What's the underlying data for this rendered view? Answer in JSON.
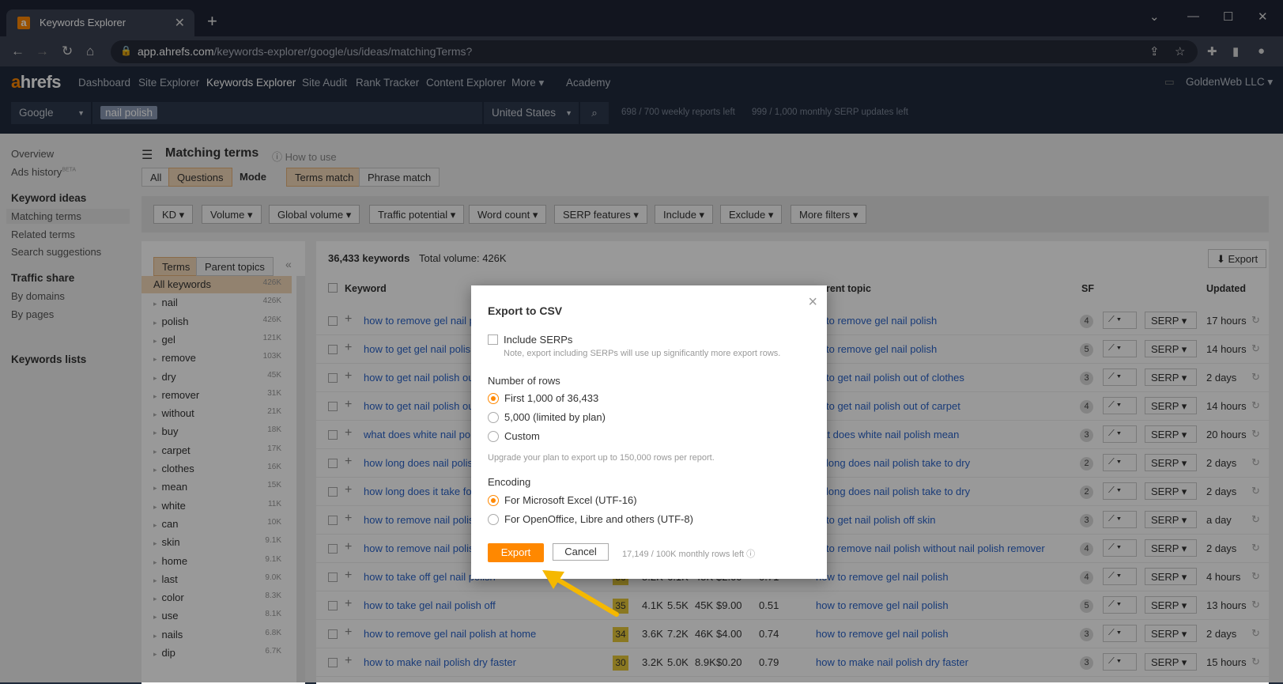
{
  "browser": {
    "tab_title": "Keywords Explorer",
    "favicon_letter": "a",
    "url_domain": "app.ahrefs.com",
    "url_path": "/keywords-explorer/google/us/ideas/matchingTerms?"
  },
  "header": {
    "logo_a": "a",
    "logo_rest": "hrefs",
    "nav": [
      "Dashboard",
      "Site Explorer",
      "Keywords Explorer",
      "Site Audit",
      "Rank Tracker",
      "Content Explorer",
      "More ▾",
      "Academy"
    ],
    "account": "GoldenWeb LLC",
    "engine": "Google",
    "query": "nail polish",
    "country": "United States",
    "weekly_quota": "698 / 700 weekly reports left",
    "monthly_quota": "999 / 1,000 monthly SERP updates left"
  },
  "sidebar": {
    "overview": "Overview",
    "ads_history": "Ads history",
    "beta": "BETA",
    "keyword_ideas": "Keyword ideas",
    "matching_terms": "Matching terms",
    "related_terms": "Related terms",
    "search_suggestions": "Search suggestions",
    "traffic_share": "Traffic share",
    "by_domains": "By domains",
    "by_pages": "By pages",
    "keywords_lists": "Keywords lists"
  },
  "main": {
    "title": "Matching terms",
    "how_to_use": "How to use",
    "tab_all": "All",
    "tab_questions": "Questions",
    "mode_label": "Mode",
    "terms_match": "Terms match",
    "phrase_match": "Phrase match",
    "filters": [
      "KD ▾",
      "Volume ▾",
      "Global volume ▾",
      "Traffic potential ▾",
      "Word count ▾",
      "SERP features ▾",
      "Include ▾",
      "Exclude ▾",
      "More filters ▾"
    ],
    "terms_tab": "Terms",
    "parent_topics_tab": "Parent topics",
    "keyword_count": "36,433 keywords",
    "total_volume": "Total volume: 426K",
    "export": "Export"
  },
  "term_groups": [
    {
      "label": "All keywords",
      "count": "426K"
    },
    {
      "label": "nail",
      "count": "426K"
    },
    {
      "label": "polish",
      "count": "426K"
    },
    {
      "label": "gel",
      "count": "121K"
    },
    {
      "label": "remove",
      "count": "103K"
    },
    {
      "label": "dry",
      "count": "45K"
    },
    {
      "label": "remover",
      "count": "31K"
    },
    {
      "label": "without",
      "count": "21K"
    },
    {
      "label": "buy",
      "count": "18K"
    },
    {
      "label": "carpet",
      "count": "17K"
    },
    {
      "label": "clothes",
      "count": "16K"
    },
    {
      "label": "mean",
      "count": "15K"
    },
    {
      "label": "white",
      "count": "11K"
    },
    {
      "label": "can",
      "count": "10K"
    },
    {
      "label": "skin",
      "count": "9.1K"
    },
    {
      "label": "home",
      "count": "9.1K"
    },
    {
      "label": "last",
      "count": "9.0K"
    },
    {
      "label": "color",
      "count": "8.3K"
    },
    {
      "label": "use",
      "count": "8.1K"
    },
    {
      "label": "nails",
      "count": "6.8K"
    },
    {
      "label": "dip",
      "count": "6.7K"
    }
  ],
  "table": {
    "col_keyword": "Keyword",
    "col_parent": "rent topic",
    "col_sf": "SF",
    "col_updated": "Updated",
    "rows": [
      {
        "kw": "how to remove gel nail p",
        "parent": "w to remove gel nail polish",
        "sf": "4",
        "upd": "17 hours"
      },
      {
        "kw": "how to get gel nail polish",
        "parent": "w to remove gel nail polish",
        "sf": "5",
        "upd": "14 hours"
      },
      {
        "kw": "how to get nail polish ou",
        "parent": "w to get nail polish out of clothes",
        "sf": "3",
        "upd": "2 days"
      },
      {
        "kw": "how to get nail polish ou",
        "parent": "w to get nail polish out of carpet",
        "sf": "4",
        "upd": "14 hours"
      },
      {
        "kw": "what does white nail pol",
        "parent": "hat does white nail polish mean",
        "sf": "3",
        "upd": "20 hours"
      },
      {
        "kw": "how long does nail polish",
        "parent": "w long does nail polish take to dry",
        "sf": "2",
        "upd": "2 days"
      },
      {
        "kw": "how long does it take fo",
        "parent": "w long does nail polish take to dry",
        "sf": "2",
        "upd": "2 days"
      },
      {
        "kw": "how to remove nail polis",
        "parent": "w to get nail polish off skin",
        "sf": "3",
        "upd": "a day"
      },
      {
        "kw": "how to remove nail polis",
        "parent": "w to remove nail polish without nail polish remover",
        "sf": "4",
        "upd": "2 days"
      },
      {
        "kw": "how to take off gel nail polish",
        "kd": "36",
        "vol": "5.2K",
        "gv": "6.1K",
        "tp": "45K",
        "cpc": "$2.00",
        "cps": "0.71",
        "parent": "how to remove gel nail polish",
        "sf": "4",
        "upd": "4 hours"
      },
      {
        "kw": "how to take gel nail polish off",
        "kd": "35",
        "vol": "4.1K",
        "gv": "5.5K",
        "tp": "45K",
        "cpc": "$9.00",
        "cps": "0.51",
        "parent": "how to remove gel nail polish",
        "sf": "5",
        "upd": "13 hours"
      },
      {
        "kw": "how to remove gel nail polish at home",
        "kd": "34",
        "vol": "3.6K",
        "gv": "7.2K",
        "tp": "46K",
        "cpc": "$4.00",
        "cps": "0.74",
        "parent": "how to remove gel nail polish",
        "sf": "3",
        "upd": "2 days"
      },
      {
        "kw": "how to make nail polish dry faster",
        "kd": "30",
        "vol": "3.2K",
        "gv": "5.0K",
        "tp": "8.9K",
        "cpc": "$0.20",
        "cps": "0.79",
        "parent": "how to make nail polish dry faster",
        "sf": "3",
        "upd": "15 hours"
      }
    ]
  },
  "modal": {
    "title": "Export to CSV",
    "include_serps": "Include SERPs",
    "include_note": "Note, export including SERPs will use up significantly more export rows.",
    "rows_heading": "Number of rows",
    "opt_first": "First 1,000 of 36,433",
    "opt_5000": "5,000 (limited by plan)",
    "opt_custom": "Custom",
    "upgrade_note": "Upgrade your plan to export up to 150,000 rows per report.",
    "encoding_heading": "Encoding",
    "enc_excel": "For Microsoft Excel (UTF-16)",
    "enc_other": "For OpenOffice, Libre and others (UTF-8)",
    "export_button": "Export",
    "cancel_button": "Cancel",
    "rows_left": "17,149 / 100K monthly rows left"
  },
  "colors": {
    "accent": "#ff8800",
    "link": "#2a63c9",
    "kd_yellow": "#e7c839",
    "arrow": "#f5b800"
  }
}
